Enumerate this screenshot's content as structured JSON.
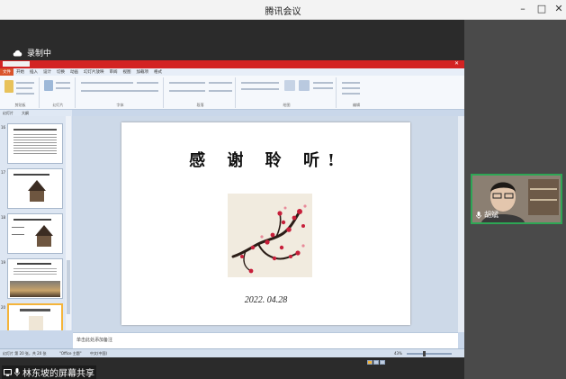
{
  "window": {
    "title": "腾讯会议",
    "minimize": "–",
    "maximize": "□",
    "close": "✕"
  },
  "recording": {
    "label": "录制中",
    "icon": "cloud-icon"
  },
  "powerpoint": {
    "tab_labels": [
      "文件",
      "开始",
      "插入",
      "设计",
      "切换",
      "动画",
      "幻灯片放映",
      "审阅",
      "视图",
      "加载项",
      "格式"
    ],
    "ribbon_groups": [
      "剪贴板",
      "幻灯片",
      "字体",
      "段落",
      "绘图",
      "编辑"
    ],
    "pane_tabs": [
      "幻灯片",
      "大纲"
    ],
    "thumbnail_numbers": [
      "16",
      "17",
      "18",
      "19",
      "20"
    ],
    "slide": {
      "heading": "感 谢 聆 听!",
      "date": "2022. 04.28",
      "image": "plum-blossom-painting"
    },
    "notes_placeholder": "单击此处添加备注",
    "status": {
      "slide_info": "幻灯片 第 20 张，共 20 张",
      "theme": "\"Office 主题\"",
      "language": "中文(中国)",
      "zoom": "43%"
    }
  },
  "participant": {
    "name": "胡斌",
    "mic_icon": "microphone-icon"
  },
  "screen_share": {
    "label": "林东坡的屏幕共享",
    "icons": [
      "screen-share-icon",
      "microphone-icon"
    ]
  }
}
